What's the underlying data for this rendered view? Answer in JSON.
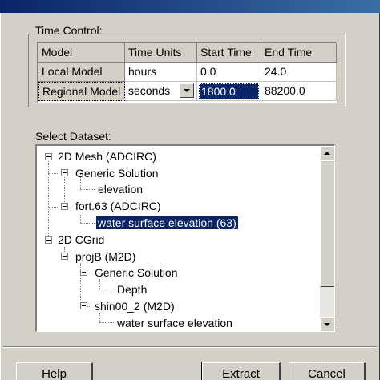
{
  "time_control": {
    "label": "Time Control:",
    "columns": [
      "Model",
      "Time Units",
      "Start Time",
      "End Time"
    ],
    "rows": [
      {
        "model": "Local Model",
        "units": "hours",
        "start": "0.0",
        "end": "24.0"
      },
      {
        "model": "Regional Model",
        "units": "seconds",
        "start": "1800.0",
        "end": "88200.0"
      }
    ]
  },
  "dataset": {
    "label": "Select Dataset:",
    "nodes": [
      {
        "text": "2D Mesh (ADCIRC)"
      },
      {
        "text": "Generic Solution"
      },
      {
        "text": "elevation"
      },
      {
        "text": "fort.63 (ADCIRC)"
      },
      {
        "text": "water surface elevation (63)",
        "selected": true
      },
      {
        "text": "2D CGrid"
      },
      {
        "text": "projB (M2D)"
      },
      {
        "text": "Generic Solution"
      },
      {
        "text": "Depth"
      },
      {
        "text": "shin00_2 (M2D)"
      },
      {
        "text": "water surface elevation"
      }
    ]
  },
  "buttons": {
    "help": "Help",
    "extract": "Extract",
    "cancel": "Cancel"
  },
  "colors": {
    "face": "#d4d0c8",
    "selection": "#0a246a",
    "titlebar": "#0a246a"
  }
}
